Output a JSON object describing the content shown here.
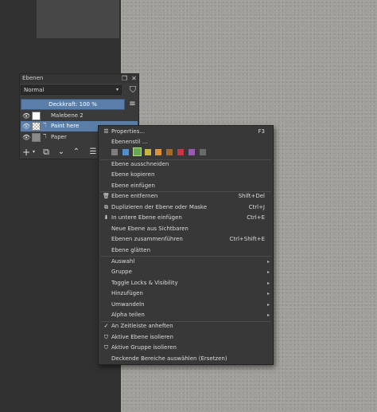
{
  "docker": {
    "title": "Ebenen",
    "blend_mode": "Normal",
    "opacity_label": "Deckkraft:  100 %",
    "layers": [
      {
        "name": "Malebene 2"
      },
      {
        "name": "Paint here"
      },
      {
        "name": "Paper"
      }
    ]
  },
  "menu": {
    "properties": "Properties...",
    "properties_sc": "F3",
    "layer_style": "Ebenenstil ...",
    "color_labels": [
      "#7f7f7f",
      "#4f8fd0",
      "#6aa84f",
      "#c8b43a",
      "#d9923a",
      "#c4532f",
      "#cc3344",
      "#9b59b6",
      "#777777"
    ],
    "cut": "Ebene ausschneiden",
    "copy": "Ebene kopieren",
    "paste": "Ebene einfügen",
    "remove": "Ebene entfernen",
    "remove_sc": "Shift+Del",
    "duplicate": "Duplizieren der Ebene oder Maske",
    "duplicate_sc": "Ctrl+J",
    "insert_below": "In untere Ebene einfügen",
    "insert_below_sc": "Ctrl+E",
    "new_from_visible": "Neue Ebene aus Sichtbaren",
    "merge": "Ebenen zusammenführen",
    "merge_sc": "Ctrl+Shift+E",
    "flatten": "Ebene glätten",
    "select": "Auswahl",
    "group": "Gruppe",
    "toggle_locks": "Toggle Locks & Visibility",
    "add": "Hinzufügen",
    "convert": "Umwandeln",
    "split_alpha": "Alpha teilen",
    "pin_timeline": "An Zeitleiste anheften",
    "isolate_layer": "Aktive Ebene isolieren",
    "isolate_group": "Aktive Gruppe isolieren",
    "select_opaque": "Deckende Bereiche auswählen (Ersetzen)"
  }
}
